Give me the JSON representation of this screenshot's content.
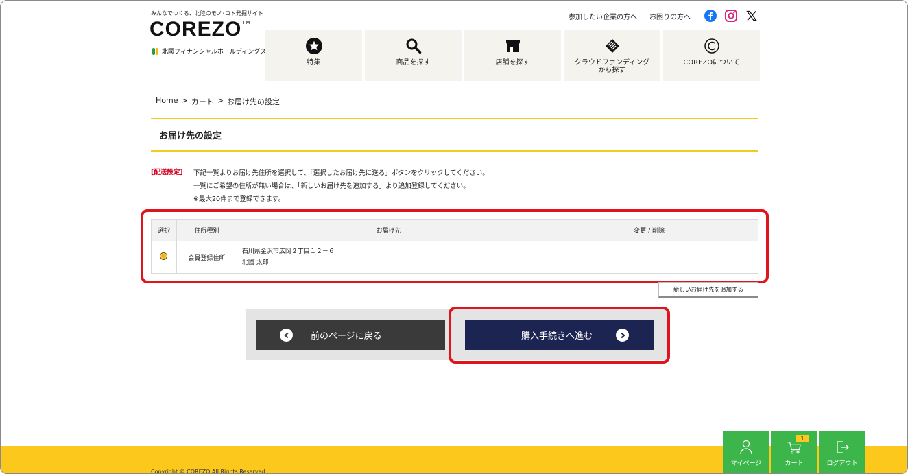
{
  "header": {
    "tagline": "みんなでつくる、北陸のモノ･コト発掘サイト",
    "logo": "COREZO",
    "logo_tm": "TM",
    "company": "北國フィナンシャルホールディングス",
    "links": [
      "参加したい企業の方へ",
      "お困りの方へ"
    ],
    "social_icons": [
      "facebook-icon",
      "instagram-icon",
      "x-icon"
    ]
  },
  "nav": [
    {
      "label": "特集",
      "icon": "star-icon"
    },
    {
      "label": "商品を探す",
      "icon": "search-icon"
    },
    {
      "label": "店舗を探す",
      "icon": "store-icon"
    },
    {
      "label": "クラウドファンディング\nから探す",
      "icon": "handshake-icon"
    },
    {
      "label": "COREZOについて",
      "icon": "corezo-c-icon"
    }
  ],
  "breadcrumb": [
    "Home",
    "カート",
    "お届け先の設定"
  ],
  "breadcrumb_sep": ">",
  "page_title": "お届け先の設定",
  "notice": {
    "tag": "[配送設定]",
    "lines": [
      "下記一覧よりお届け先住所を選択して、「選択したお届け先に送る」ボタンをクリックしてください。",
      "一覧にご希望の住所が無い場合は、「新しいお届け先を追加する」より追加登録してください。",
      "※最大20件まで登録できます。"
    ]
  },
  "table": {
    "headers": [
      "選択",
      "住所種別",
      "お届け先",
      "変更 / 削除"
    ],
    "rows": [
      {
        "selected": true,
        "type": "会員登録住所",
        "address_line1": "石川県金沢市広岡２丁目１２－６",
        "address_line2": "北國 太郎"
      }
    ]
  },
  "add_address_label": "新しいお届け先を追加する",
  "buttons": {
    "back": "前のページに戻る",
    "next": "購入手続きへ進む"
  },
  "footer": {
    "copyright": "Copyright © COREZO All Rights Reserved."
  },
  "fixed_bar": {
    "mypage": "マイページ",
    "cart": "カート",
    "cart_count": "1",
    "logout": "ログアウト"
  },
  "colors": {
    "accent_yellow": "#fcc81c",
    "nav_bg": "#f4f3ee",
    "next_button": "#1c2552",
    "back_button": "#3a3a3a",
    "fixed_bar_green": "#3cb54a",
    "highlight_red": "#e0141c"
  }
}
